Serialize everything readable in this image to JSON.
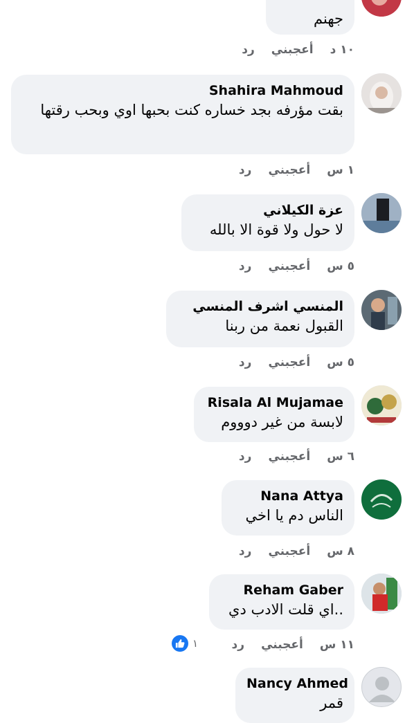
{
  "comments": [
    {
      "name": "",
      "text": "جهنم",
      "time": "١٠ د",
      "like": "أعجبني",
      "reply": "رد"
    },
    {
      "name": "Shahira Mahmoud",
      "text": "بقت مؤرفه بجد خساره كنت بحبها اوي وبحب رقتها",
      "time": "١ س",
      "like": "أعجبني",
      "reply": "رد"
    },
    {
      "name": "عزة الكيلاني",
      "text": "لا حول ولا قوة الا بالله",
      "time": "٥ س",
      "like": "أعجبني",
      "reply": "رد"
    },
    {
      "name": "المنسي اشرف المنسي",
      "text": "القبول نعمة من ربنا",
      "time": "٥ س",
      "like": "أعجبني",
      "reply": "رد"
    },
    {
      "name": "Risala Al Mujamae",
      "text": "لابسة من غير دوووم",
      "time": "٦ س",
      "like": "أعجبني",
      "reply": "رد"
    },
    {
      "name": "Nana Attya",
      "text": "الناس دم يا اخي",
      "time": "٨ س",
      "like": "أعجبني",
      "reply": "رد"
    },
    {
      "name": "Reham Gaber",
      "text": "..اي قلت الادب دي",
      "time": "١١ س",
      "like": "أعجبني",
      "reply": "رد",
      "reaction_count": "١"
    },
    {
      "name": "Nancy Ahmed",
      "text": "قمر",
      "time": "",
      "like": "",
      "reply": ""
    }
  ],
  "colors": {
    "bubble": "#f0f2f5",
    "meta": "#65676b",
    "like_blue": "#1877f2"
  },
  "icons": {
    "reaction": "thumbs-up-icon",
    "default_avatar": "default-avatar-icon"
  }
}
